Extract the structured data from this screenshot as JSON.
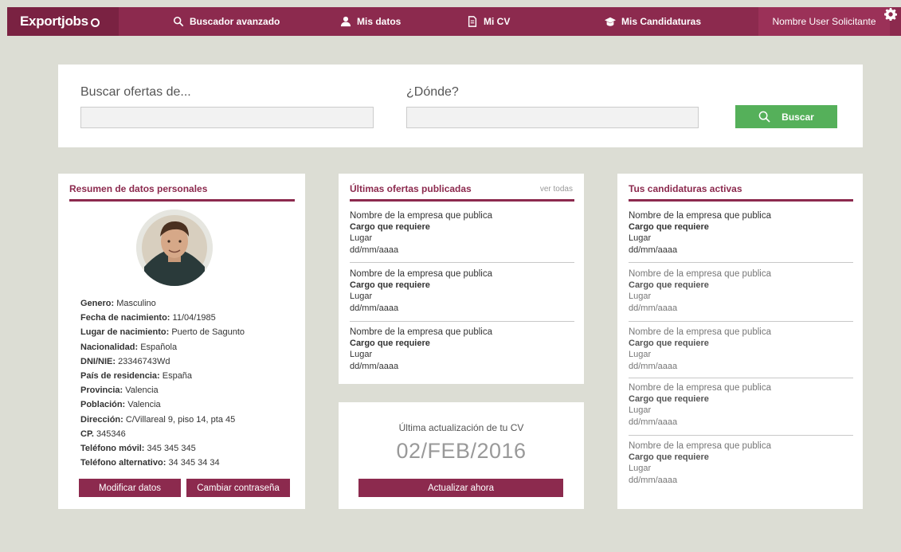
{
  "header": {
    "logo": "Exportjobs",
    "nav": [
      {
        "label": "Buscador avanzado",
        "icon": "search-icon"
      },
      {
        "label": "Mis datos",
        "icon": "user-icon"
      },
      {
        "label": "Mi CV",
        "icon": "document-icon"
      },
      {
        "label": "Mis Candidaturas",
        "icon": "graduation-cap-icon"
      }
    ],
    "user_name": "Nombre User Solicitante",
    "settings_icon": "gear-icon"
  },
  "search": {
    "what_label": "Buscar ofertas de...",
    "where_label": "¿Dónde?",
    "what_value": "",
    "where_value": "",
    "button_label": "Buscar"
  },
  "profile_card": {
    "title": "Resumen de datos personales",
    "fields": [
      {
        "label": "Genero:",
        "value": "Masculino"
      },
      {
        "label": "Fecha de nacimiento:",
        "value": "11/04/1985"
      },
      {
        "label": "Lugar de nacimiento:",
        "value": "Puerto de Sagunto"
      },
      {
        "label": "Nacionalidad:",
        "value": "Española"
      },
      {
        "label": "DNI/NIE:",
        "value": "23346743Wd"
      },
      {
        "label": "País de residencia:",
        "value": "España"
      },
      {
        "label": "Provincia:",
        "value": "Valencia"
      },
      {
        "label": "Población:",
        "value": "Valencia"
      },
      {
        "label": "Dirección:",
        "value": "C/Villareal 9, piso 14, pta 45"
      },
      {
        "label": "CP.",
        "value": "345346"
      },
      {
        "label": "Teléfono móvil:",
        "value": "345 345 345"
      },
      {
        "label": "Teléfono alternativo:",
        "value": "34 345 34 34"
      }
    ],
    "modify_label": "Modificar datos",
    "password_label": "Cambiar contraseña"
  },
  "offers_card": {
    "title": "Últimas ofertas publicadas",
    "see_all": "ver todas",
    "items": [
      {
        "company": "Nombre de la empresa que publica",
        "position": "Cargo que requiere",
        "place": "Lugar",
        "date": "dd/mm/aaaa"
      },
      {
        "company": "Nombre de la empresa que publica",
        "position": "Cargo que requiere",
        "place": "Lugar",
        "date": "dd/mm/aaaa"
      },
      {
        "company": "Nombre de la empresa que publica",
        "position": "Cargo que requiere",
        "place": "Lugar",
        "date": "dd/mm/aaaa"
      }
    ]
  },
  "cv_card": {
    "label": "Última actualización de tu CV",
    "date": "02/FEB/2016",
    "button_label": "Actualizar ahora"
  },
  "applications_card": {
    "title": "Tus candidaturas activas",
    "items": [
      {
        "company": "Nombre de la empresa que publica",
        "position": "Cargo que requiere",
        "place": "Lugar",
        "date": "dd/mm/aaaa"
      },
      {
        "company": "Nombre de la empresa que publica",
        "position": "Cargo que requiere",
        "place": "Lugar",
        "date": "dd/mm/aaaa"
      },
      {
        "company": "Nombre de la empresa que publica",
        "position": "Cargo que requiere",
        "place": "Lugar",
        "date": "dd/mm/aaaa"
      },
      {
        "company": "Nombre de la empresa que publica",
        "position": "Cargo que requiere",
        "place": "Lugar",
        "date": "dd/mm/aaaa"
      },
      {
        "company": "Nombre de la empresa que publica",
        "position": "Cargo que requiere",
        "place": "Lugar",
        "date": "dd/mm/aaaa"
      }
    ]
  },
  "colors": {
    "brand": "#8c2a4e",
    "search_button": "#55b05a",
    "background": "#dcddd4"
  }
}
